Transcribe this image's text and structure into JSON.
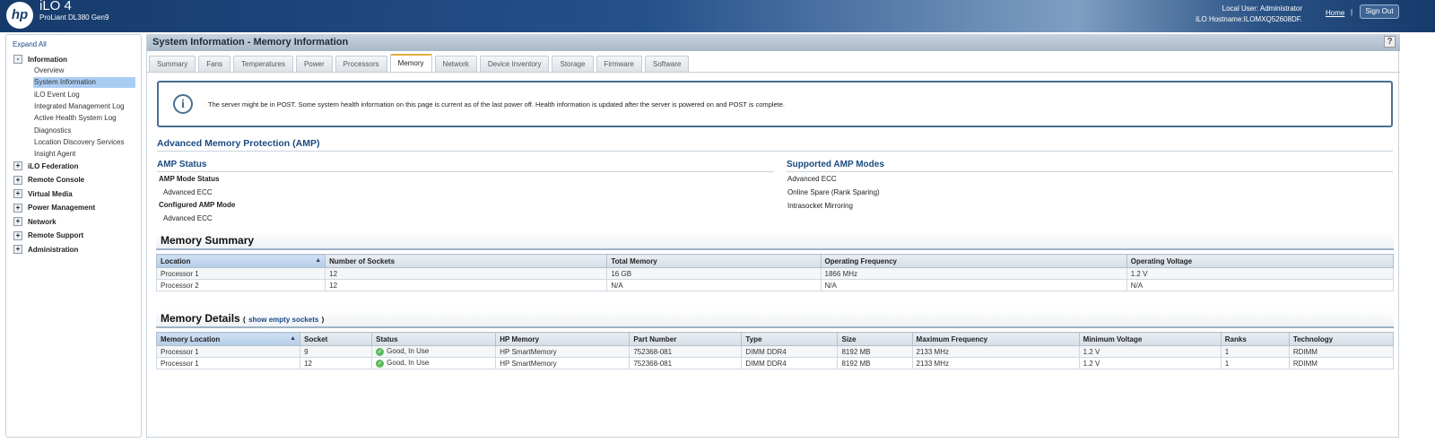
{
  "header": {
    "logo": "hp",
    "app": "iLO 4",
    "model": "ProLiant DL380 Gen9",
    "user": "Local User:  Administrator",
    "hostname": "iLO Hostname:ILOMXQ52608DF.",
    "home": "Home",
    "sep": "|",
    "signout": "Sign Out"
  },
  "sidebar": {
    "expand_all": "Expand All",
    "information": {
      "toggle": "-",
      "label": "Information",
      "items": [
        "Overview",
        "System Information",
        "iLO Event Log",
        "Integrated Management Log",
        "Active Health System Log",
        "Diagnostics",
        "Location Discovery Services",
        "Insight Agent"
      ]
    },
    "groups": [
      {
        "toggle": "+",
        "label": "iLO Federation"
      },
      {
        "toggle": "+",
        "label": "Remote Console"
      },
      {
        "toggle": "+",
        "label": "Virtual Media"
      },
      {
        "toggle": "+",
        "label": "Power Management"
      },
      {
        "toggle": "+",
        "label": "Network"
      },
      {
        "toggle": "+",
        "label": "Remote Support"
      },
      {
        "toggle": "+",
        "label": "Administration"
      }
    ]
  },
  "main": {
    "title": "System Information - Memory Information",
    "help": "?",
    "tabs": [
      "Summary",
      "Fans",
      "Temperatures",
      "Power",
      "Processors",
      "Memory",
      "Network",
      "Device Inventory",
      "Storage",
      "Firmware",
      "Software"
    ],
    "active_tab": "Memory",
    "info": "The server might be in POST. Some system health information on this page is current as of the last power off. Health information is updated after the server is powered on and POST is complete.",
    "amp": {
      "heading": "Advanced Memory Protection (AMP)",
      "status_heading": "AMP Status",
      "mode_status_label": "AMP Mode Status",
      "mode_status": "Advanced ECC",
      "configured_label": "Configured AMP Mode",
      "configured": "Advanced ECC",
      "supported_heading": "Supported AMP Modes",
      "supported": [
        "Advanced ECC",
        "Online Spare (Rank Sparing)",
        "Intrasocket Mirroring"
      ]
    },
    "summary": {
      "heading": "Memory Summary",
      "columns": [
        "Location",
        "Number of Sockets",
        "Total Memory",
        "Operating Frequency",
        "Operating Voltage"
      ],
      "rows": [
        [
          "Processor 1",
          "12",
          "16 GB",
          "1866 MHz",
          "1.2 V"
        ],
        [
          "Processor 2",
          "12",
          "N/A",
          "N/A",
          "N/A"
        ]
      ]
    },
    "details": {
      "heading": "Memory Details",
      "open": "(",
      "link": "show empty sockets",
      "close": ")",
      "columns": [
        "Memory Location",
        "Socket",
        "Status",
        "HP Memory",
        "Part Number",
        "Type",
        "Size",
        "Maximum Frequency",
        "Minimum Voltage",
        "Ranks",
        "Technology"
      ],
      "rows": [
        [
          "Processor 1",
          "9",
          "Good, In Use",
          "HP SmartMemory",
          "752368-081",
          "DIMM DDR4",
          "8192 MB",
          "2133 MHz",
          "1.2 V",
          "1",
          "RDIMM"
        ],
        [
          "Processor 1",
          "12",
          "Good, In Use",
          "HP SmartMemory",
          "752368-081",
          "DIMM DDR4",
          "8192 MB",
          "2133 MHz",
          "1.2 V",
          "1",
          "RDIMM"
        ]
      ]
    }
  }
}
